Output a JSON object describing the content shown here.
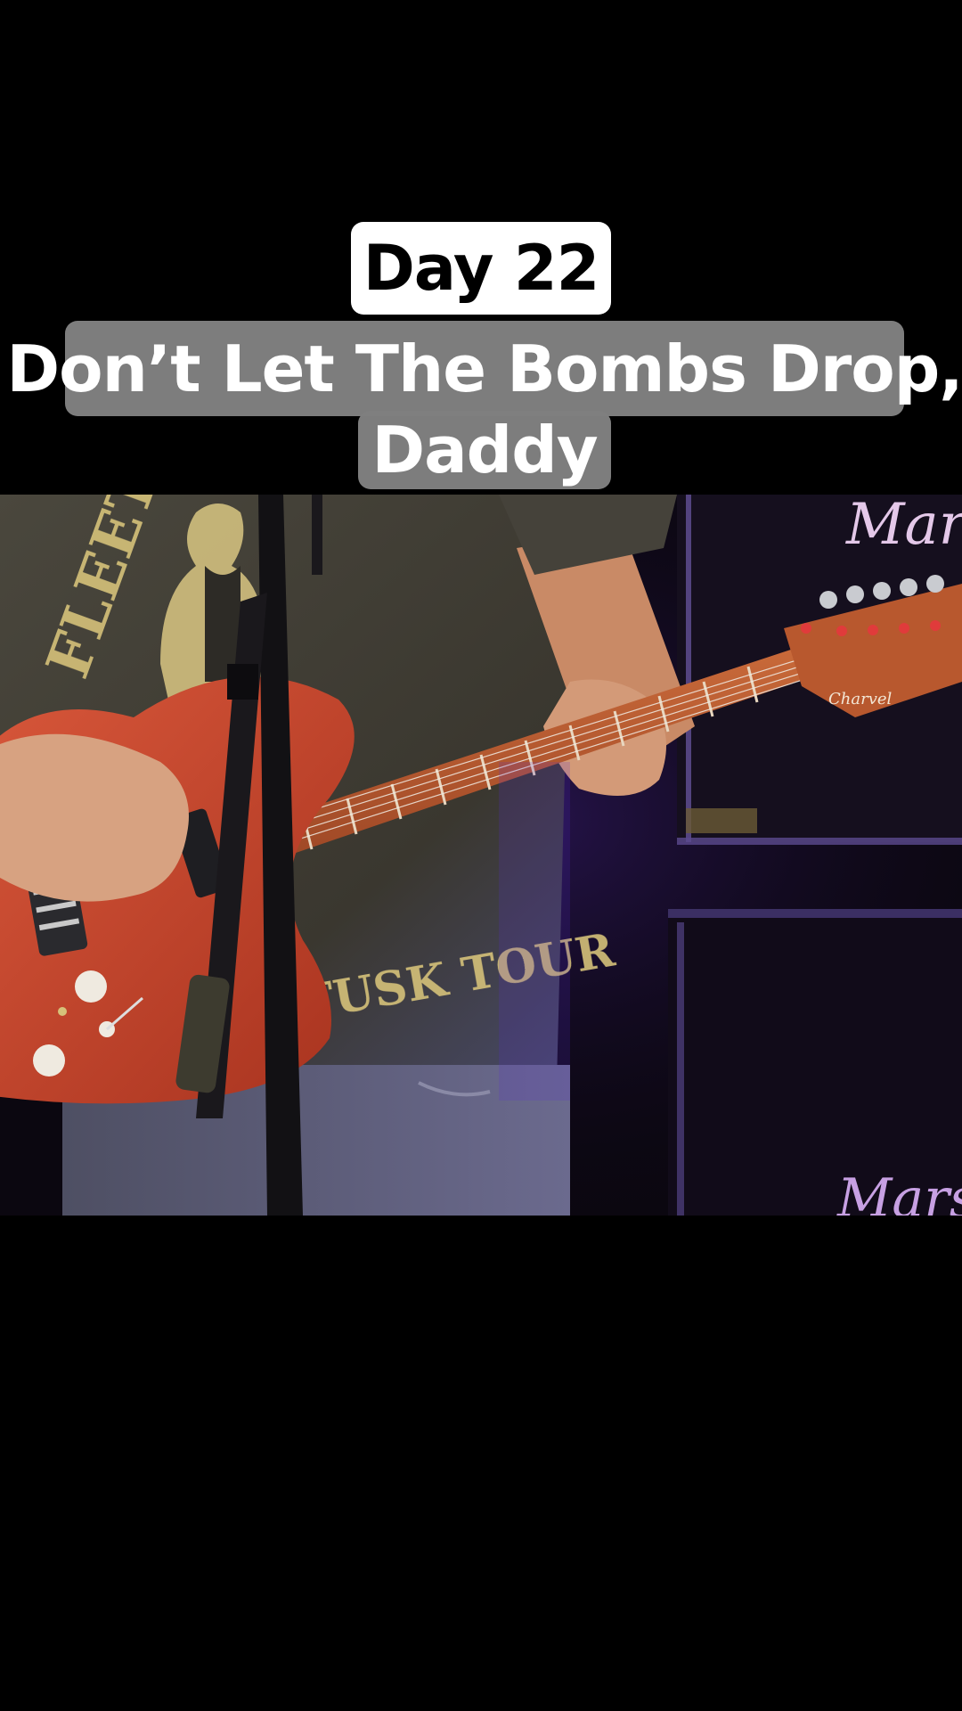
{
  "overlay": {
    "day_label": "Day 22",
    "title_line_1": "Don’t Let The Bombs Drop,",
    "title_line_2": "Daddy"
  },
  "video": {
    "amp_brand_text": "Marsh",
    "shirt_text_top": "FLEETWOOD MAC",
    "shirt_text_bottom": "TUSK TOUR",
    "headstock_logo": "Charvel",
    "colors": {
      "guitar_body": "#c9472f",
      "neck": "#b9582e",
      "shirt": "#3d3a32",
      "amp": "#120c18",
      "stage_light": "#5a2fd0"
    }
  }
}
